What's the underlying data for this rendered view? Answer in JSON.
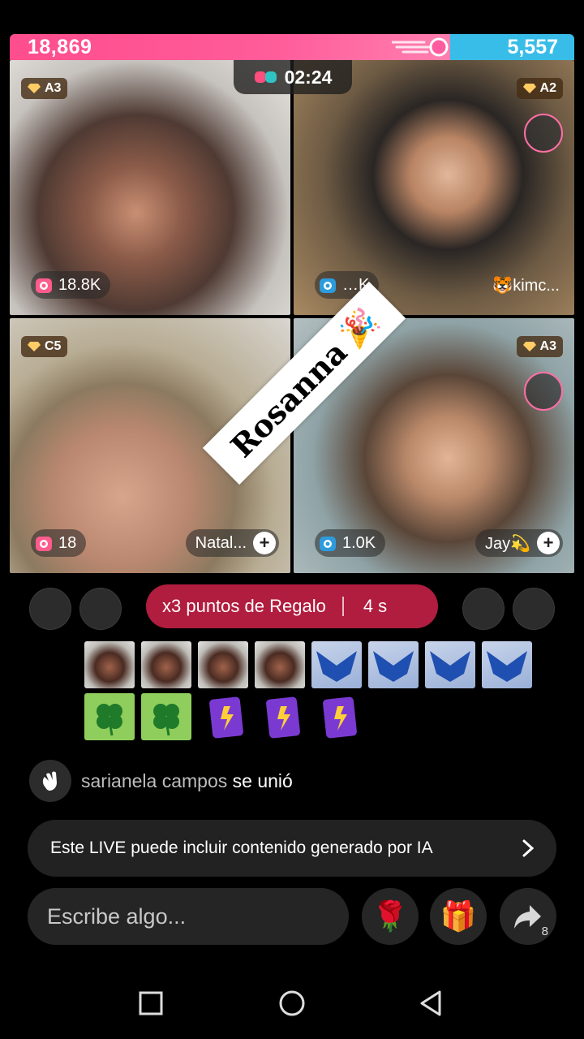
{
  "battle": {
    "left_score": "18,869",
    "right_score": "5,557",
    "timer": "02:24",
    "colors": {
      "left": "#ff4d8d",
      "right": "#38bde8"
    }
  },
  "tiles": [
    {
      "rank": "A3",
      "likes": "18.8K",
      "like_icon": "pink-heart-icon",
      "name": ""
    },
    {
      "rank": "A2",
      "likes": "…K",
      "like_icon": "blue-heart-icon",
      "name": "🐯kimc..."
    },
    {
      "rank": "C5",
      "likes": "18",
      "like_icon": "pink-heart-icon",
      "name": "Natal..."
    },
    {
      "rank": "A3",
      "likes": "1.0K",
      "like_icon": "blue-heart-icon",
      "name": "Jay💫"
    }
  ],
  "banner": {
    "text": "Rosanna",
    "icon": "🎉"
  },
  "regalo": {
    "label": "x3 puntos de Regalo",
    "seconds": "4 s"
  },
  "join": {
    "user": "sarianela campos",
    "action": "se unió"
  },
  "ai_notice": {
    "text": "Este LIVE puede incluir contenido generado por IA"
  },
  "composer": {
    "placeholder": "Escribe algo..."
  },
  "actions": {
    "rose": "🌹",
    "gift": "🎁",
    "share_count": "8"
  }
}
